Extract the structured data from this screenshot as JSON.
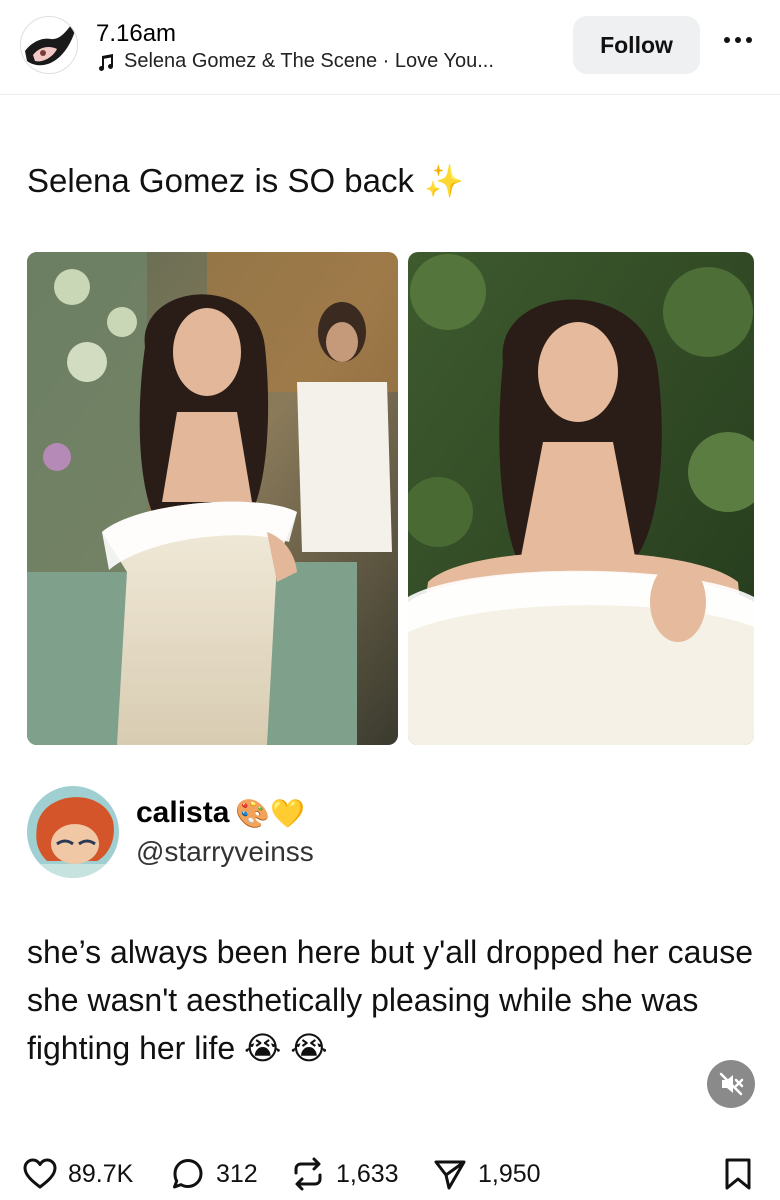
{
  "post": {
    "time": "7.16am",
    "audio": "Selena Gomez & The Scene · Love You...",
    "follow_label": "Follow",
    "caption": "Selena Gomez is SO back",
    "caption_emoji": "✨"
  },
  "quoted": {
    "name": "calista",
    "name_emojis": "🎨💛",
    "handle": "@starryveinss",
    "text": "she’s always been here but y'all dropped her cause she wasn't aesthetically pleasing while she was fighting her life",
    "text_emojis": "😭 😭"
  },
  "stats": {
    "likes": "89.7K",
    "comments": "312",
    "reposts": "1,633",
    "shares": "1,950"
  },
  "icons": {
    "music": "music-note-icon",
    "more": "more-dots-icon",
    "like": "heart-icon",
    "comment": "comment-icon",
    "repost": "repost-icon",
    "share": "send-icon",
    "save": "bookmark-icon",
    "mute": "speaker-muted-icon"
  }
}
